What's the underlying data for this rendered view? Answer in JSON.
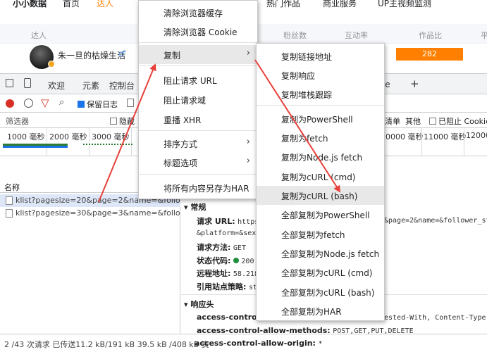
{
  "site": {
    "logo": "小小数据",
    "nav": [
      "首页",
      "达人",
      "热门作品",
      "商业服务",
      "UP主视频监测"
    ],
    "table_headers": [
      "达人",
      "粉丝数",
      "互动率",
      "作品比",
      "平"
    ],
    "row1": {
      "name": "朱一旦的枯燥生活",
      "gender": "♂",
      "value": "282"
    }
  },
  "devtools": {
    "tabs": [
      "欢迎",
      "元素",
      "控制台",
      "se",
      "+"
    ],
    "toolbar": {
      "preserve_log": "保留日志"
    },
    "filter": {
      "label": "筛选器",
      "hide": "隐藏",
      "right_a": "清单",
      "right_b": "其他",
      "block_cookie": "已阻止 Cookie"
    },
    "timeline_left": [
      "1000 毫秒",
      "2000 毫秒",
      "3000 毫秒"
    ],
    "timeline_right": [
      "0000 毫秒",
      "11000 毫秒",
      "12000"
    ],
    "name_col": "名称",
    "requests": [
      "klist?pagesize=20&page=2&name=&follower_st...",
      "klist?pagesize=30&page=3&name=&follower_st..."
    ],
    "general": {
      "section": "常规",
      "url_key": "请求 URL:",
      "url_val": "https:",
      "url_tail": "&page=2&name=&follower_sta",
      "url_line2": "&platform=&sex=",
      "method_key": "请求方法:",
      "method_val": "GET",
      "status_key": "状态代码:",
      "status_val": "200",
      "remote_key": "远程地址:",
      "remote_val": "58.218",
      "referrer_key": "引用站点策略:",
      "referrer_val": "str"
    },
    "response": {
      "section": "响应头",
      "h1_key": "access-control-all",
      "h1_tail": "ested-With, Content-Type,",
      "h2_key": "access-control-allow-methods:",
      "h2_val": "POST,GET,PUT,DELETE",
      "h3_key": "access-control-allow-origin:",
      "h3_val": "*"
    },
    "status_bar": "2 /43 次请求  已传送11.2 kB/191 kB  39.5 kB /408 kB 资"
  },
  "menu": {
    "items": [
      "清除浏览器缓存",
      "清除浏览器 Cookie",
      "复制",
      "阻止请求 URL",
      "阻止请求域",
      "重播 XHR",
      "排序方式",
      "标题选项",
      "将所有内容另存为HAR"
    ]
  },
  "submenu": {
    "items": [
      "复制链接地址",
      "复制响应",
      "复制堆栈跟踪",
      "复制为PowerShell",
      "复制为fetch",
      "复制为Node.js fetch",
      "复制为cURL (cmd)",
      "复制为cURL (bash)",
      "全部复制为PowerShell",
      "全部复制为fetch",
      "全部复制为Node.js fetch",
      "全部复制为cURL (cmd)",
      "全部复制为cURL (bash)",
      "全部复制为HAR"
    ]
  },
  "colors": {
    "accent_orange": "#ff8000",
    "arrow_red": "#e8403a",
    "record_red": "#d93025",
    "status_green": "#1e8e3e"
  }
}
